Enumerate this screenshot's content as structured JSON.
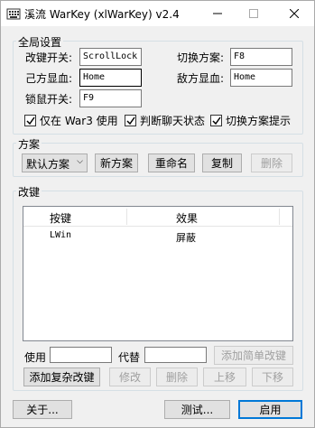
{
  "window": {
    "title": "溪流 WarKey (xlWarKey) v2.4"
  },
  "global": {
    "group_label": "全局设置",
    "remap_toggle_label": "改键开关:",
    "remap_toggle_value": "ScrollLock",
    "switch_scheme_label": "切换方案:",
    "switch_scheme_value": "F8",
    "ally_hp_label": "己方显血:",
    "ally_hp_value": "Home",
    "enemy_hp_label": "敌方显血:",
    "enemy_hp_value": "Home",
    "lock_mouse_label": "锁鼠开关:",
    "lock_mouse_value": "F9",
    "only_war3_label": "仅在 War3 使用",
    "detect_chat_label": "判断聊天状态",
    "switch_prompt_label": "切换方案提示"
  },
  "scheme": {
    "group_label": "方案",
    "selected": "默认方案",
    "new_label": "新方案",
    "rename_label": "重命名",
    "copy_label": "复制",
    "delete_label": "删除"
  },
  "remap": {
    "group_label": "改键",
    "columns": [
      "按键",
      "效果"
    ],
    "rows": [
      {
        "key": "LWin",
        "effect": "屏蔽"
      }
    ],
    "use_label": "使用",
    "replace_label": "代替",
    "add_simple_label": "添加简单改键",
    "add_complex_label": "添加复杂改键",
    "modify_label": "修改",
    "delete_label": "删除",
    "move_up_label": "上移",
    "move_down_label": "下移"
  },
  "footer": {
    "about_label": "关于...",
    "test_label": "测试...",
    "enable_label": "启用"
  }
}
